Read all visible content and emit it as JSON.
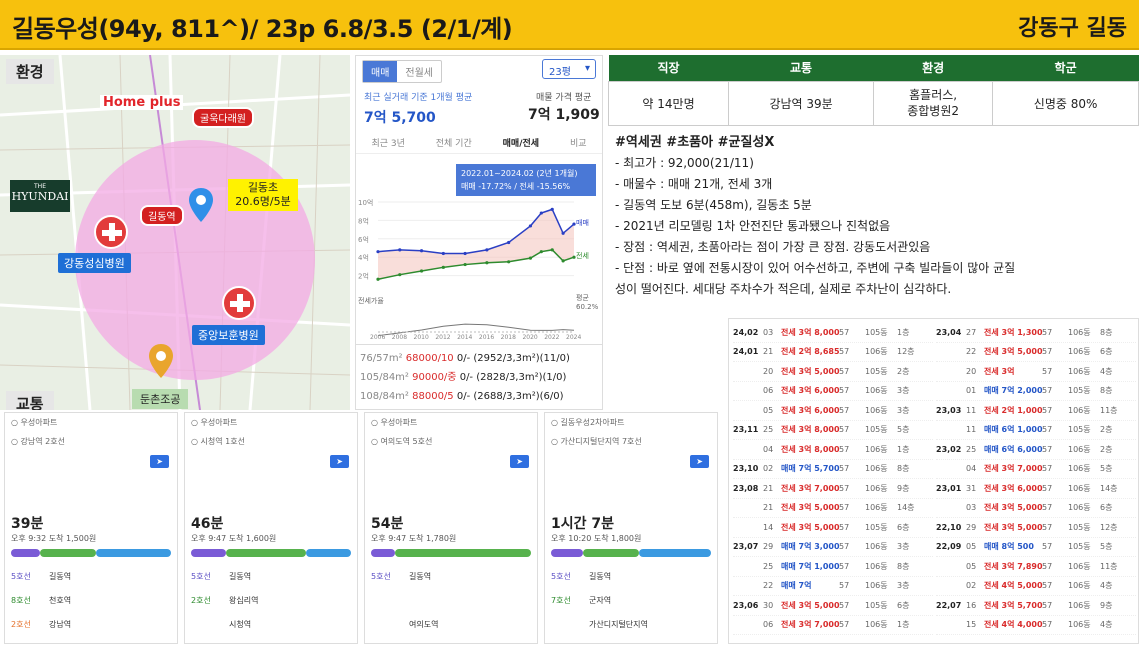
{
  "header": {
    "title": "길동우성(94y, 811^)/ 23p 6.8/3.5 (2/1/계)",
    "location": "강동구 길동"
  },
  "map": {
    "section_label": "환경",
    "transit_label": "교통",
    "homeplus": "Home plus",
    "hyundai_top": "THE",
    "hyundai": "HYUNDAI",
    "gulmok": "굴욱다래원",
    "station": "길동역",
    "school_box": "길동초\n20.6명/5분",
    "hospital1": "강동성심병원",
    "hospital2": "중앙보훈병원",
    "park": "둔촌조공"
  },
  "price_panel": {
    "tab_sale": "매매",
    "tab_rent": "전월세",
    "size_select": "23평",
    "recent_label": "최근 실거래 기준 1개월 평균",
    "recent_value": "7억 5,700",
    "ask_label": "매물 가격 평균",
    "ask_value": "7억 1,909",
    "period_tabs": [
      "최근 3년",
      "전체 기간",
      "매매/전세",
      "비교"
    ],
    "tooltip_line1": "2022.01~2024.02 (2년 1개월)",
    "tooltip_line2": "매매 -17.72% / 전세 -15.56%",
    "legend_sale": "매매",
    "legend_rent": "전세",
    "y_ticks": [
      "10억",
      "8억",
      "6억",
      "4억",
      "2억"
    ],
    "ratio_label": "전세가율",
    "ratio_avg": "평균",
    "ratio_avg_value": "60.2%",
    "x_ticks": [
      "2006",
      "2008",
      "2010",
      "2012",
      "2014",
      "2016",
      "2018",
      "2020",
      "2022",
      "2024"
    ],
    "units": [
      {
        "size": "76/57m²",
        "counts": "68000/10",
        "rest": "0/- (2952/3,3m²)(11/0)"
      },
      {
        "size": "105/84m²",
        "counts": "90000/중",
        "rest": "0/- (2828/3,3m²)(1/0)"
      },
      {
        "size": "108/84m²",
        "counts": "88000/5",
        "rest": "0/- (2688/3,3m²)(6/0)"
      }
    ]
  },
  "chart_data": {
    "type": "line",
    "x": [
      2006,
      2008,
      2010,
      2012,
      2014,
      2016,
      2018,
      2020,
      2021,
      2022,
      2023,
      2024
    ],
    "series": [
      {
        "name": "매매",
        "values": [
          4.6,
          4.8,
          4.7,
          4.4,
          4.4,
          4.8,
          5.6,
          7.4,
          8.8,
          9.2,
          6.6,
          7.6
        ]
      },
      {
        "name": "전세",
        "values": [
          1.6,
          2.1,
          2.5,
          2.9,
          3.2,
          3.4,
          3.5,
          3.9,
          4.6,
          4.8,
          3.6,
          4.0
        ]
      }
    ],
    "ylim": [
      0,
      10
    ],
    "ylabel": "억"
  },
  "table": {
    "headers": [
      "직장",
      "교통",
      "환경",
      "학군"
    ],
    "values": [
      "약 14만명",
      "강남역 39분",
      "홈플러스,\n종합병원2",
      "신명중 80%"
    ]
  },
  "notes": {
    "hashtags": "#역세권 #초품아 #균질성X",
    "lines": [
      "- 최고가 : 92,000(21/11)",
      "- 매물수 : 매매 21개, 전세 3개",
      "- 길동역 도보 6분(458m), 길동초 5분",
      "- 2021년 리모델링 1차 안전진단 통과됐으나 진척없음",
      "- 장점 : 역세권, 초품아라는 점이 가장 큰 장점. 강동도서관있음",
      "- 단점 : 바로 옆에 전통시장이 있어 어수선하고, 주변에 구축 빌라들이 많아 균질",
      "성이 떨어진다. 세대당 주차수가 적은데, 실제로 주차난이 심각하다."
    ]
  },
  "transit_cards": [
    {
      "from": "우성아파트",
      "to": "강남역 2호선",
      "time": "39분",
      "detail": "오후 9:32 도착 1,500원",
      "line1": "5호선",
      "stop1": "길동역",
      "line2": "8호선",
      "stop2": "천호역",
      "line3": "2호선",
      "stop3": "강남역",
      "bar": [
        0.18,
        0.35,
        0.47
      ]
    },
    {
      "from": "우성아파트",
      "to": "시청역 1호선",
      "time": "46분",
      "detail": "오후 9:47 도착 1,600원",
      "line1": "5호선",
      "stop1": "길동역",
      "line2": "2호선",
      "stop2": "왕십리역",
      "line3": "",
      "stop3": "시청역",
      "bar": [
        0.22,
        0.5,
        0.28
      ]
    },
    {
      "from": "우성아파트",
      "to": "여의도역 5호선",
      "time": "54분",
      "detail": "오후 9:47 도착 1,780원",
      "line1": "5호선",
      "stop1": "길동역",
      "line2": "",
      "stop2": "",
      "line3": "",
      "stop3": "여의도역",
      "bar": [
        0.15,
        0.85,
        0
      ]
    },
    {
      "from": "길동우성2차아파트",
      "to": "가산디지털단지역 7호선",
      "time": "1시간 7분",
      "detail": "오후 10:20 도착 1,800원",
      "line1": "5호선",
      "stop1": "길동역",
      "line2": "7호선",
      "stop2": "군자역",
      "line3": "",
      "stop3": "가산디지털단지역",
      "bar": [
        0.2,
        0.35,
        0.45
      ]
    }
  ],
  "deals_left": [
    {
      "d": "24,02",
      "day": "03",
      "kind": "전세",
      "price": "3억 8,000",
      "a": "57",
      "dong": "105동",
      "fl": "1층"
    },
    {
      "d": "24,01",
      "day": "21",
      "kind": "전세",
      "price": "2억 8,685",
      "a": "57",
      "dong": "106동",
      "fl": "12층"
    },
    {
      "d": "",
      "day": "20",
      "kind": "전세",
      "price": "3억 5,000",
      "a": "57",
      "dong": "105동",
      "fl": "2층"
    },
    {
      "d": "",
      "day": "06",
      "kind": "전세",
      "price": "3억 6,000",
      "a": "57",
      "dong": "106동",
      "fl": "3층"
    },
    {
      "d": "",
      "day": "05",
      "kind": "전세",
      "price": "3억 6,000",
      "a": "57",
      "dong": "106동",
      "fl": "3층"
    },
    {
      "d": "23,11",
      "day": "25",
      "kind": "전세",
      "price": "3억 8,000",
      "a": "57",
      "dong": "105동",
      "fl": "5층"
    },
    {
      "d": "",
      "day": "04",
      "kind": "전세",
      "price": "3억 8,000",
      "a": "57",
      "dong": "106동",
      "fl": "1층"
    },
    {
      "d": "23,10",
      "day": "02",
      "kind": "매매",
      "price": "7억 5,700",
      "a": "57",
      "dong": "106동",
      "fl": "8층"
    },
    {
      "d": "23,08",
      "day": "21",
      "kind": "전세",
      "price": "3억 7,000",
      "a": "57",
      "dong": "106동",
      "fl": "9층"
    },
    {
      "d": "",
      "day": "21",
      "kind": "전세",
      "price": "3억 5,000",
      "a": "57",
      "dong": "106동",
      "fl": "14층"
    },
    {
      "d": "",
      "day": "14",
      "kind": "전세",
      "price": "3억 5,000",
      "a": "57",
      "dong": "105동",
      "fl": "6층"
    },
    {
      "d": "23,07",
      "day": "29",
      "kind": "매매",
      "price": "7억 3,000",
      "a": "57",
      "dong": "106동",
      "fl": "3층"
    },
    {
      "d": "",
      "day": "25",
      "kind": "매매",
      "price": "7억 1,000",
      "a": "57",
      "dong": "106동",
      "fl": "8층"
    },
    {
      "d": "",
      "day": "22",
      "kind": "매매",
      "price": "7억",
      "a": "57",
      "dong": "106동",
      "fl": "3층"
    },
    {
      "d": "23,06",
      "day": "30",
      "kind": "전세",
      "price": "3억 5,000",
      "a": "57",
      "dong": "105동",
      "fl": "6층"
    },
    {
      "d": "",
      "day": "06",
      "kind": "전세",
      "price": "3억 7,000",
      "a": "57",
      "dong": "106동",
      "fl": "1층"
    }
  ],
  "deals_right": [
    {
      "d": "23,04",
      "day": "27",
      "kind": "전세",
      "price": "3억 1,300",
      "a": "57",
      "dong": "106동",
      "fl": "8층"
    },
    {
      "d": "",
      "day": "22",
      "kind": "전세",
      "price": "3억 5,000",
      "a": "57",
      "dong": "106동",
      "fl": "6층"
    },
    {
      "d": "",
      "day": "20",
      "kind": "전세",
      "price": "3억",
      "a": "57",
      "dong": "106동",
      "fl": "4층"
    },
    {
      "d": "",
      "day": "01",
      "kind": "매매",
      "price": "7억 2,000",
      "a": "57",
      "dong": "105동",
      "fl": "8층"
    },
    {
      "d": "23,03",
      "day": "11",
      "kind": "전세",
      "price": "2억 1,000",
      "a": "57",
      "dong": "106동",
      "fl": "11층"
    },
    {
      "d": "",
      "day": "11",
      "kind": "매매",
      "price": "6억 1,000",
      "a": "57",
      "dong": "105동",
      "fl": "2층"
    },
    {
      "d": "23,02",
      "day": "25",
      "kind": "매매",
      "price": "6억 6,000",
      "a": "57",
      "dong": "106동",
      "fl": "2층"
    },
    {
      "d": "",
      "day": "04",
      "kind": "전세",
      "price": "3억 7,000",
      "a": "57",
      "dong": "106동",
      "fl": "5층"
    },
    {
      "d": "23,01",
      "day": "31",
      "kind": "전세",
      "price": "3억 6,000",
      "a": "57",
      "dong": "106동",
      "fl": "14층"
    },
    {
      "d": "",
      "day": "03",
      "kind": "전세",
      "price": "3억 5,000",
      "a": "57",
      "dong": "106동",
      "fl": "6층"
    },
    {
      "d": "22,10",
      "day": "29",
      "kind": "전세",
      "price": "3억 5,000",
      "a": "57",
      "dong": "105동",
      "fl": "12층"
    },
    {
      "d": "22,09",
      "day": "05",
      "kind": "매매",
      "price": "8억 500",
      "a": "57",
      "dong": "105동",
      "fl": "5층"
    },
    {
      "d": "",
      "day": "05",
      "kind": "전세",
      "price": "3억 7,890",
      "a": "57",
      "dong": "106동",
      "fl": "11층"
    },
    {
      "d": "",
      "day": "02",
      "kind": "전세",
      "price": "4억 5,000",
      "a": "57",
      "dong": "106동",
      "fl": "4층"
    },
    {
      "d": "22,07",
      "day": "16",
      "kind": "전세",
      "price": "3억 5,700",
      "a": "57",
      "dong": "106동",
      "fl": "9층"
    },
    {
      "d": "",
      "day": "15",
      "kind": "전세",
      "price": "4억 4,000",
      "a": "57",
      "dong": "106동",
      "fl": "4층"
    }
  ],
  "colors": {
    "accent": "#f7c10d",
    "header_green": "#1e6e2f",
    "sale_line": "#2a3fc4",
    "rent_line": "#2e8b2e",
    "red": "#d92b2b"
  }
}
